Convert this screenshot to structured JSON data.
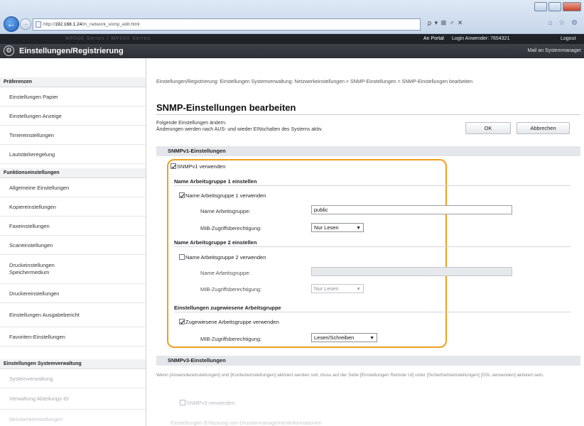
{
  "browser": {
    "url_prefix": "http://",
    "url_host": "192.168.1.24",
    "url_path": "/m_network_snmp_edit.html",
    "search_tools": "ρ ▾ ⊠ ♂ ✕",
    "tab_tools": "⌂ ☆ ⚙",
    "back_glyph": "←",
    "fwd_glyph": "→"
  },
  "portal_bar": {
    "device_name": "MF000 Series / MF000 Series",
    "portal_link": "An Portal",
    "login_label": "Login Anwender:  7654321",
    "logout": "Logout"
  },
  "header": {
    "app_title": "Einstellungen/Registrierung",
    "mail_link": "Mail an Systemmanager"
  },
  "sidebar": {
    "sections": [
      {
        "label": "Präferenzen",
        "items": [
          "Einstellungen Papier",
          "Einstellungen Anzeige",
          "Timereinstellungen",
          "Lautstärkeregelung"
        ]
      },
      {
        "label": "Funktionseinstellungen",
        "items": [
          "Allgemeine Einstellungen",
          "Kopiereinstellungen",
          "Faxeinstellungen",
          "Scaneinstellungen",
          "Druckeinstellungen Speichermedium",
          "Druckereinstellungen",
          "Einstellungen Ausgabebericht",
          "Favoriten-Einstellungen"
        ]
      },
      {
        "label": "Einstellungen Systemverwaltung",
        "items": [
          "Systemverwaltung",
          "Verwaltung Abteilungs-ID",
          "Netzwerkeinstellungen"
        ]
      }
    ]
  },
  "main": {
    "breadcrumb": "Einstellungen/Registrierung: Einstellungen Systemverwaltung: Netzwerkeinstellungen > SNMP-Einstellungen > SNMP-Einstellungen bearbeiten",
    "title": "SNMP-Einstellungen bearbeiten",
    "intro_line1": "Folgende Einstellungen ändern.",
    "intro_line2": "Änderungen werden nach AUS- und wieder EINschalten des Systems aktiv.",
    "ok_label": "OK",
    "cancel_label": "Abbrechen",
    "snmpv1": {
      "section_title": "SNMPv1-Einstellungen",
      "use_label": "SNMPv1 verwenden",
      "use_checked": true,
      "group1": {
        "heading": "Name Arbeitsgruppe 1 einstellen",
        "use_label": "Name Arbeitsgruppe 1 verwenden",
        "use_checked": true,
        "name_label": "Name Arbeitsgruppe:",
        "name_value": "public",
        "mib_label": "MIB-Zugriffsberechtigung:",
        "mib_value": "Nur Lesen"
      },
      "group2": {
        "heading": "Name Arbeitsgruppe 2 einstellen",
        "use_label": "Name Arbeitsgruppe 2 verwenden",
        "use_checked": false,
        "name_label": "Name Arbeitsgruppe:",
        "name_value": "",
        "mib_label": "MIB-Zugriffsberechtigung:",
        "mib_value": "Nur Lesen"
      },
      "dedicated": {
        "heading": "Einstellungen zugewiesene Arbeitsgruppe",
        "use_label": "Zugewiesene Arbeitsgruppe verwenden",
        "use_checked": true,
        "mib_label": "MIB-Zugriffsberechtigung:",
        "mib_value": "Lesen/Schreiben"
      }
    },
    "snmpv3": {
      "section_title": "SNMPv3-Einstellungen",
      "note": "Wenn [Anwendereinstellungen] und [Kontexteinstellungen] aktiviert werden soll, muss auf der Seite [Einstellungen Remote UI] unter [Sicherheitseinstellungen] [SSL verwenden] aktiviert sein.",
      "use_label": "SNMPv3 verwenden",
      "more_label": "Einstellungen Erfassung von Druckermanagementinformationen"
    }
  }
}
